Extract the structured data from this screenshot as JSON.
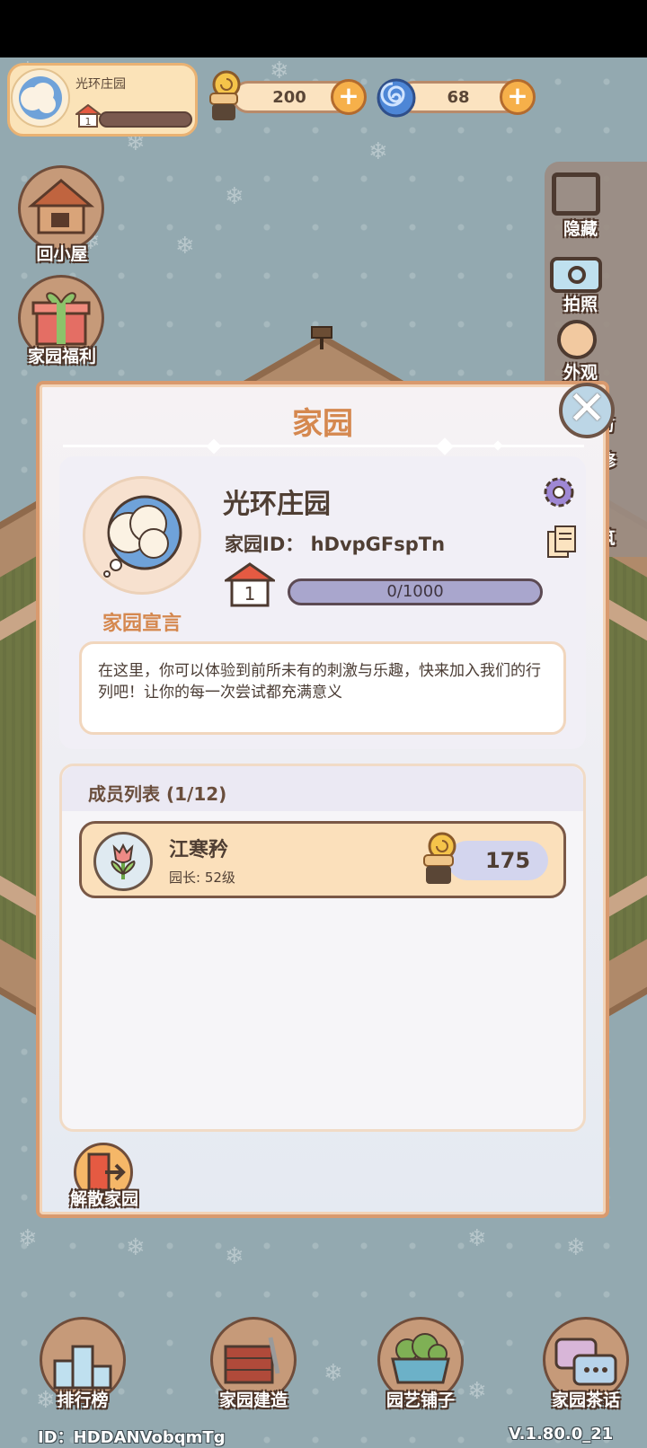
{
  "profile": {
    "name": "光环庄园",
    "level": "1"
  },
  "currency": {
    "snail_coins": "200",
    "spiral_gems": "68",
    "plus": "+"
  },
  "left_buttons": {
    "home": "回小屋",
    "welfare": "家园福利"
  },
  "right_panel": {
    "hide": "隐藏",
    "photo": "拍照",
    "appearance": "外观",
    "visit": "拜访",
    "repair": "修",
    "build": "筑"
  },
  "dialog": {
    "title": "家园",
    "close": "✕",
    "garden_name": "光环庄园",
    "garden_id_label": "家园ID：",
    "garden_id": "hDvpGFspTn",
    "level": "1",
    "exp": "0/1000",
    "exp_fraction": 0,
    "motto_label": "家园宣言",
    "motto_text": "在这里，你可以体验到前所未有的刺激与乐趣，快来加入我们的行列吧！让你的每一次尝试都充满意义",
    "members_title": "成员列表 (1/12)",
    "members": [
      {
        "name": "江寒矜",
        "role_level": "园长: 52级",
        "score": "175"
      }
    ],
    "disband": "解散家园"
  },
  "bottom_nav": {
    "ranking": "排行榜",
    "build": "家园建造",
    "shop": "园艺铺子",
    "chat": "家园茶话"
  },
  "footer": {
    "user_id": "ID：HDDANVobqmTg",
    "version": "V.1.80.0_21"
  },
  "colors": {
    "accent": "#d5884f",
    "exp_bar": "#a9a6cd",
    "panel_border": "#d99a6e"
  }
}
